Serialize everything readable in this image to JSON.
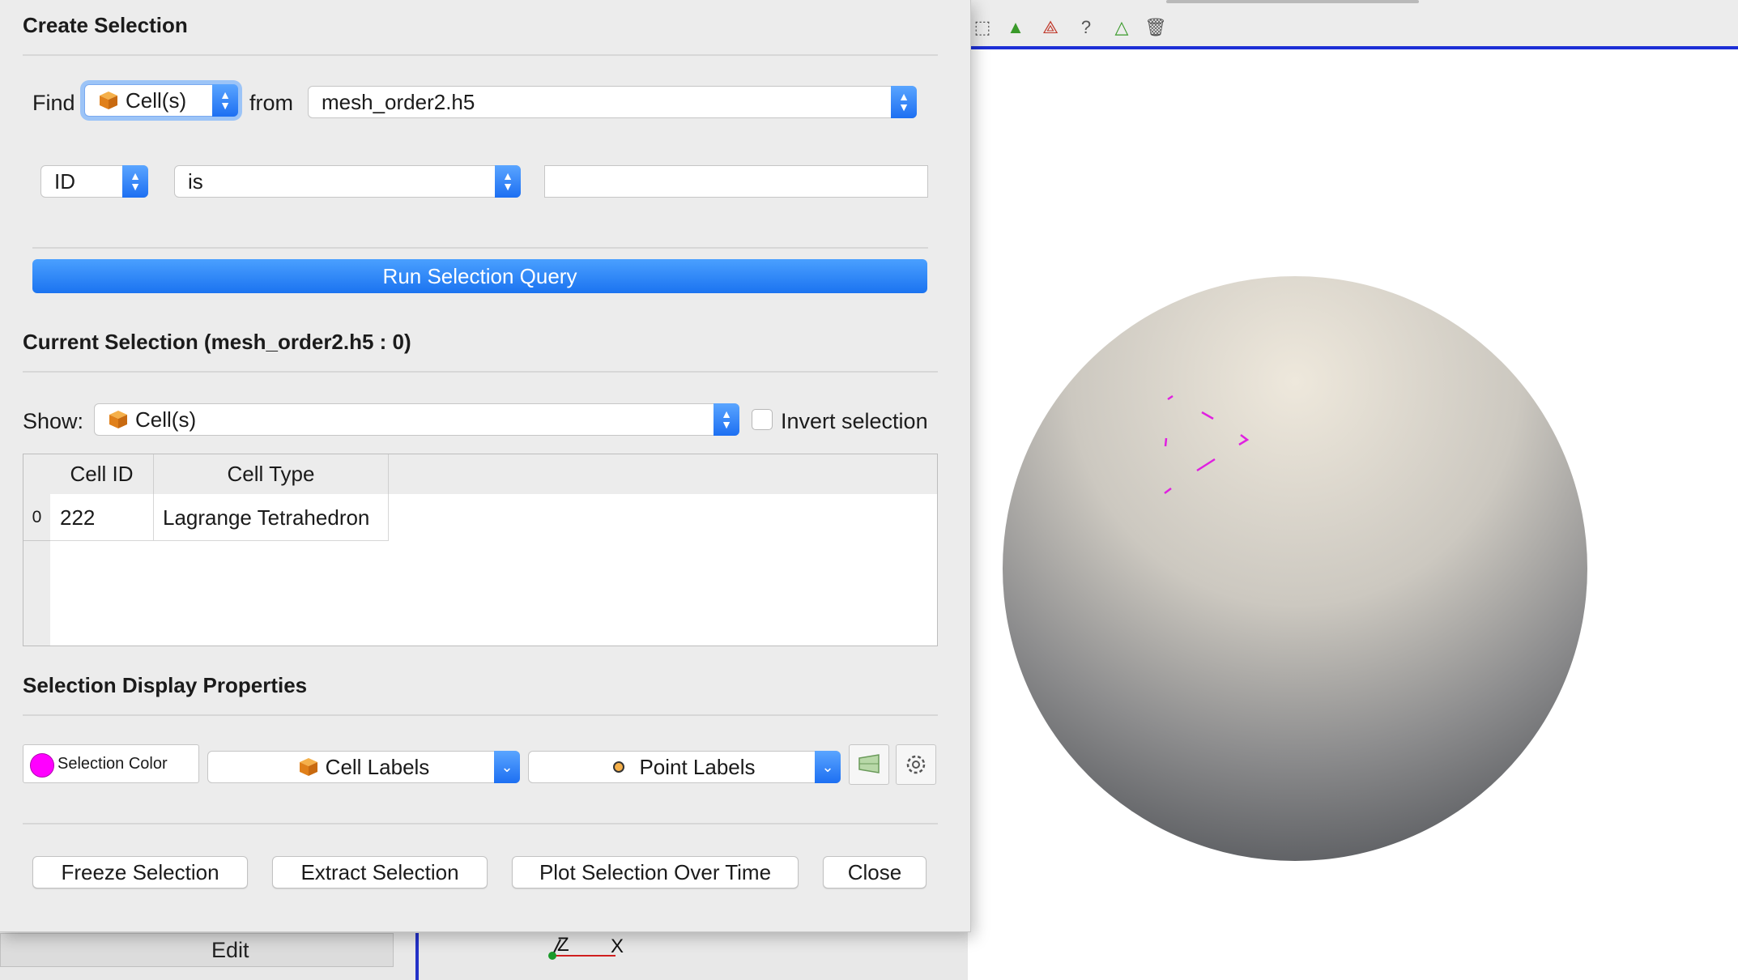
{
  "dialog": {
    "create_title": "Create Selection",
    "find_label": "Find",
    "find_value": "Cell(s)",
    "from_label": "from",
    "source_value": "mesh_order2.h5",
    "field_value": "ID",
    "op_value": "is",
    "query_value": "",
    "run_label": "Run Selection Query",
    "current_title": "Current Selection (mesh_order2.h5 : 0)",
    "show_label": "Show:",
    "show_value": "Cell(s)",
    "invert_label": "Invert selection",
    "table": {
      "headers": [
        "Cell ID",
        "Cell Type"
      ],
      "rows": [
        {
          "index": "0",
          "cell_id": "222",
          "cell_type": "Lagrange Tetrahedron"
        }
      ]
    },
    "display_title": "Selection Display Properties",
    "selection_color_label": "Selection Color",
    "selection_color": "#ff00ff",
    "cell_labels": "Cell Labels",
    "point_labels": "Point Labels",
    "buttons": {
      "freeze": "Freeze Selection",
      "extract": "Extract Selection",
      "plot": "Plot Selection Over Time",
      "close": "Close"
    }
  },
  "background": {
    "edit_label": "Edit",
    "axis_z": "Z",
    "axis_x": "X",
    "toolbar_icons": [
      "select-points-icon",
      "interactive-select-icon",
      "select-on-icon",
      "hover-points-icon",
      "hover-cells-icon",
      "clear-selection-icon"
    ]
  },
  "colors": {
    "accent": "#1d6ff2",
    "viewport_divider": "#1c2fd6"
  }
}
